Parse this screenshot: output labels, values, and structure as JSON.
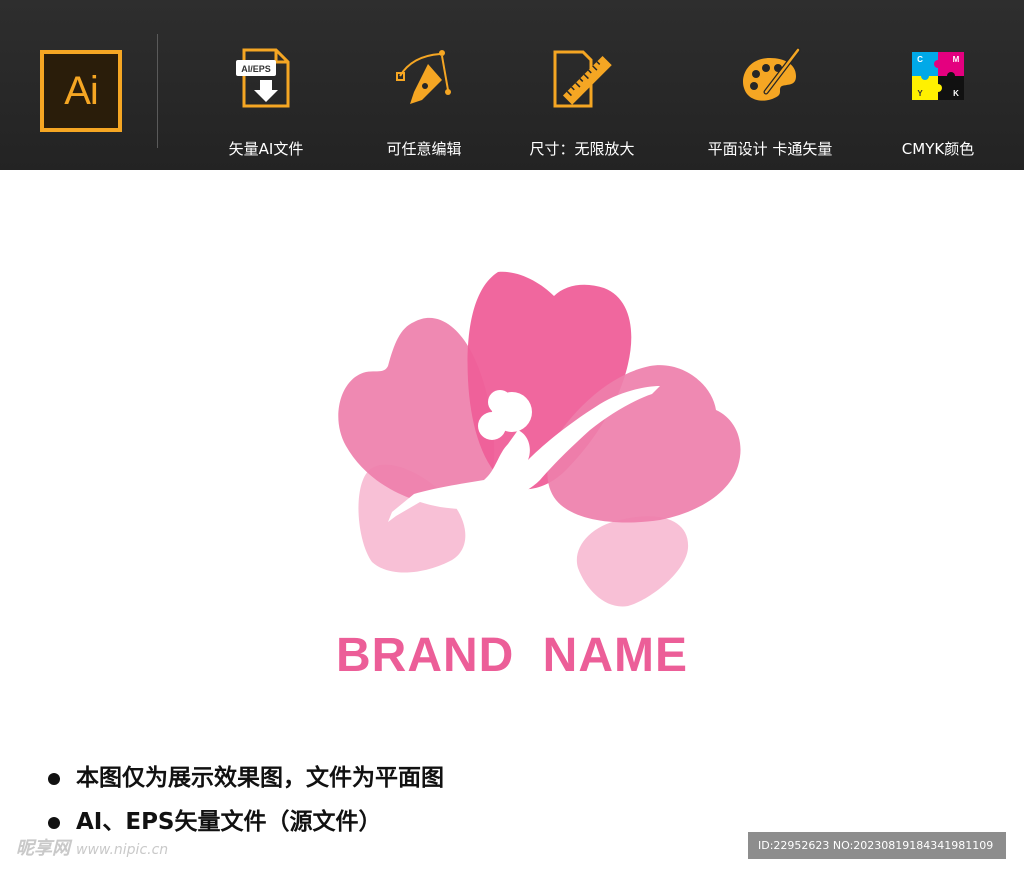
{
  "header": {
    "badge": "Ai",
    "features": [
      {
        "icon": "ai-eps-file-icon",
        "label": "矢量AI文件",
        "file_tag": "AI/EPS"
      },
      {
        "icon": "pen-tool-icon",
        "label": "可任意编辑"
      },
      {
        "icon": "ruler-document-icon",
        "label": "尺寸：无限放大"
      },
      {
        "icon": "palette-brush-icon",
        "label": "平面设计  卡通矢量"
      },
      {
        "icon": "cmyk-puzzle-icon",
        "label": "CMYK颜色",
        "letters": [
          "C",
          "M",
          "Y",
          "K"
        ]
      }
    ]
  },
  "brand_name": "BRAND  NAME",
  "notes": [
    "本图仅为展示效果图，文件为平面图",
    "AI、EPS矢量文件（源文件）"
  ],
  "watermark": {
    "text": "昵享网",
    "url": "www.nipic.cn"
  },
  "id_line": "ID:22952623 NO:20230819184341981109",
  "colors": {
    "accent": "#f5a623",
    "brand": "#ec5e98",
    "petal_dark": "#ef5f99",
    "petal_mid": "#ee7fab",
    "petal_light": "#f7b9d1",
    "topbar": "#262626"
  }
}
